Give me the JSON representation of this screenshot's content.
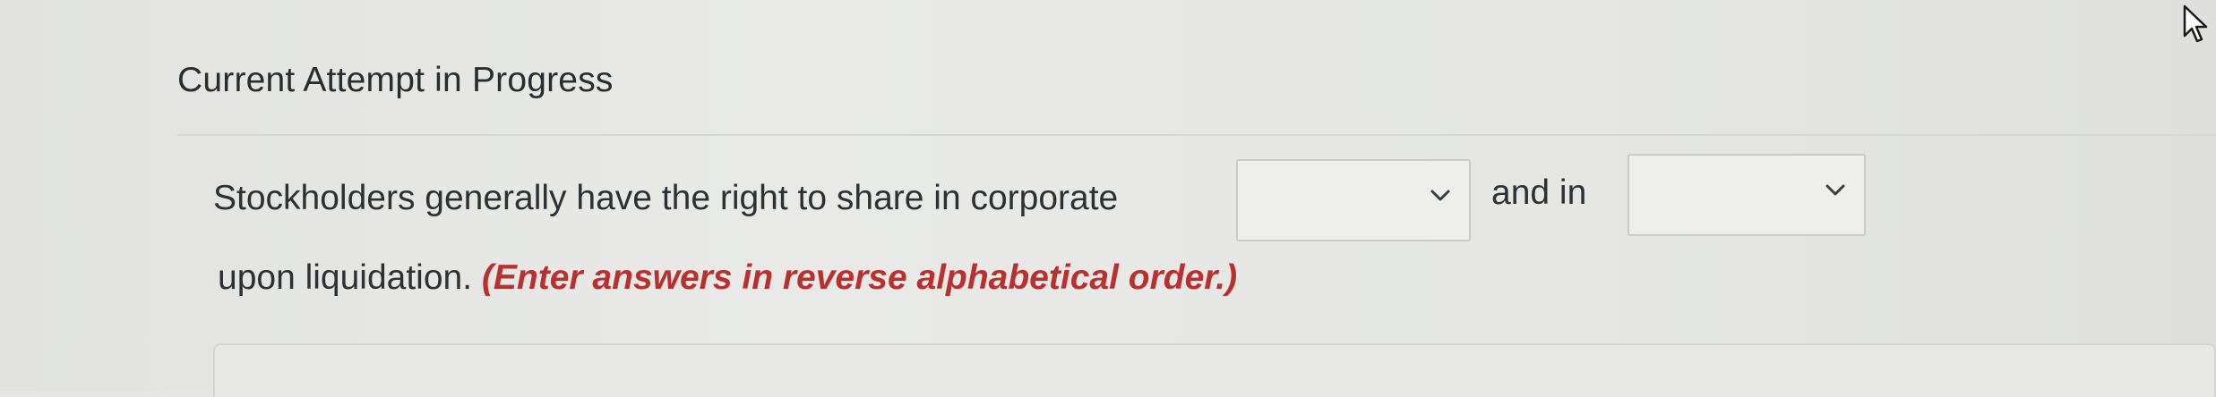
{
  "header": {
    "title": "Current Attempt in Progress"
  },
  "question": {
    "text_before_first": "Stockholders generally have the right to share in corporate",
    "text_between": "and in",
    "text_after": "upon liquidation.",
    "instruction": "(Enter answers in reverse alphabetical order.)"
  },
  "dropdowns": [
    {
      "selected": "",
      "icon": "chevron-down-icon"
    },
    {
      "selected": "",
      "icon": "chevron-down-icon"
    }
  ],
  "colors": {
    "instruction": "#b8312f",
    "text": "#2e3134",
    "background": "#e6e7e5"
  },
  "icons": {
    "cursor": "mouse-pointer-icon"
  }
}
